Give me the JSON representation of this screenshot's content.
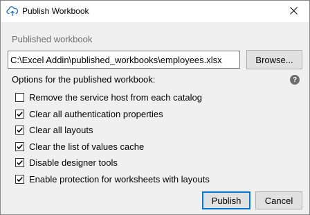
{
  "window": {
    "title": "Publish Workbook"
  },
  "published": {
    "label": "Published workbook",
    "path_value": "C:\\Excel Addin\\published_workbooks\\employees.xlsx",
    "browse_label": "Browse..."
  },
  "options": {
    "label": "Options for the published workbook:",
    "help_glyph": "?",
    "items": [
      {
        "label": "Remove the service host from each catalog",
        "checked": false
      },
      {
        "label": "Clear all authentication properties",
        "checked": true
      },
      {
        "label": "Clear all layouts",
        "checked": true
      },
      {
        "label": "Clear the list of values cache",
        "checked": true
      },
      {
        "label": "Disable designer tools",
        "checked": true
      },
      {
        "label": "Enable protection for worksheets with layouts",
        "checked": true
      }
    ]
  },
  "buttons": {
    "publish_label": "Publish",
    "cancel_label": "Cancel"
  },
  "colors": {
    "accent": "#0078d7",
    "help_icon_bg": "#6e6e6e",
    "window_bg": "#f0f0f0"
  },
  "icons": {
    "title": "cloud-upload-icon",
    "close": "close-icon",
    "help": "help-icon",
    "checkmark": "checkmark-icon"
  }
}
